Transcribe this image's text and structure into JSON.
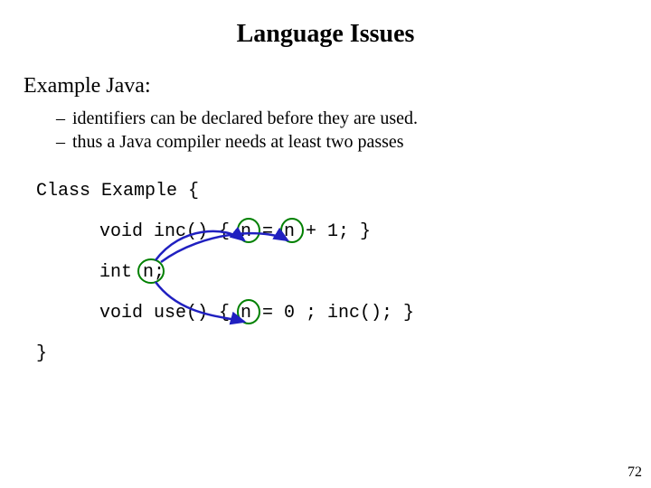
{
  "title": "Language Issues",
  "subhead": "Example Java:",
  "bullets": [
    "identifiers can be declared before they are used.",
    "thus a Java compiler needs at least two passes"
  ],
  "code": {
    "class_open": "Class Example {",
    "inc": "void inc() { n = n + 1; }",
    "decl": "int n;",
    "use": "void use() { n = 0 ; inc(); }",
    "class_close": "}"
  },
  "annotation_color": "#2020c0",
  "circle_color": "#008000",
  "page_number": "72"
}
